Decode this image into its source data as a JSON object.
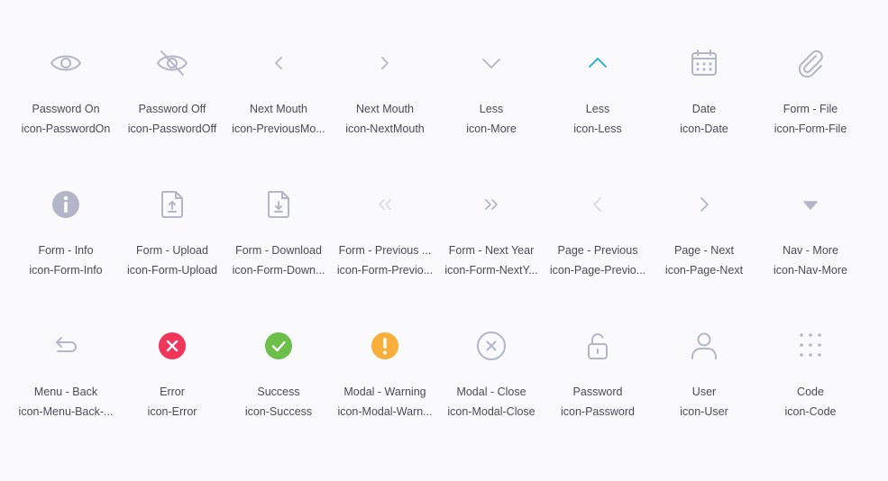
{
  "colors": {
    "icon_default": "#b3b6c9",
    "icon_faded": "#d9dbe5",
    "icon_active": "#19b1c9",
    "error": "#f2355b",
    "success": "#6cc04a",
    "warning": "#f9ad3b",
    "text": "#4a4a57"
  },
  "icons": [
    {
      "name": "Password On",
      "class": "icon-PasswordOn",
      "icon": "eye-icon"
    },
    {
      "name": "Password Off",
      "class": "icon-PasswordOff",
      "icon": "eye-off-icon"
    },
    {
      "name": "Next Mouth",
      "class": "icon-PreviousMo...",
      "icon": "chevron-left-icon"
    },
    {
      "name": "Next Mouth",
      "class": "icon-NextMouth",
      "icon": "chevron-right-icon"
    },
    {
      "name": "Less",
      "class": "icon-More",
      "icon": "chevron-down-icon"
    },
    {
      "name": "Less",
      "class": "icon-Less",
      "icon": "chevron-up-icon"
    },
    {
      "name": "Date",
      "class": "icon-Date",
      "icon": "calendar-icon"
    },
    {
      "name": "Form - File",
      "class": "icon-Form-File",
      "icon": "paperclip-icon"
    },
    {
      "name": "Form - Info",
      "class": "icon-Form-Info",
      "icon": "info-icon"
    },
    {
      "name": "Form - Upload",
      "class": "icon-Form-Upload",
      "icon": "file-upload-icon"
    },
    {
      "name": "Form - Download",
      "class": "icon-Form-Down...",
      "icon": "file-download-icon"
    },
    {
      "name": "Form - Previous ...",
      "class": "icon-Form-Previo...",
      "icon": "double-chevron-left-icon"
    },
    {
      "name": "Form - Next Year",
      "class": "icon-Form-NextY...",
      "icon": "double-chevron-right-icon"
    },
    {
      "name": "Page - Previous",
      "class": "icon-Page-Previo...",
      "icon": "page-previous-icon"
    },
    {
      "name": "Page - Next",
      "class": "icon-Page-Next",
      "icon": "page-next-icon"
    },
    {
      "name": "Nav - More",
      "class": "icon-Nav-More",
      "icon": "caret-down-icon"
    },
    {
      "name": "Menu - Back",
      "class": "icon-Menu-Back-...",
      "icon": "return-arrow-icon"
    },
    {
      "name": "Error",
      "class": "icon-Error",
      "icon": "error-icon"
    },
    {
      "name": "Success",
      "class": "icon-Success",
      "icon": "success-icon"
    },
    {
      "name": "Modal - Warning",
      "class": "icon-Modal-Warn...",
      "icon": "warning-icon"
    },
    {
      "name": "Modal - Close",
      "class": "icon-Modal-Close",
      "icon": "close-circle-icon"
    },
    {
      "name": "Password",
      "class": "icon-Password",
      "icon": "lock-icon"
    },
    {
      "name": "User",
      "class": "icon-User",
      "icon": "user-icon"
    },
    {
      "name": "Code",
      "class": "icon-Code",
      "icon": "grid-dots-icon"
    }
  ]
}
